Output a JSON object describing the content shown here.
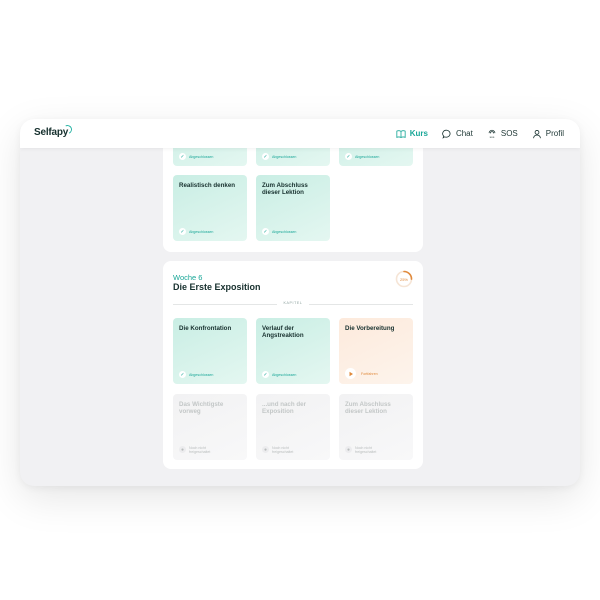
{
  "app": {
    "logo": "Selfapy",
    "nav": [
      {
        "label": "Kurs",
        "icon": "book-icon",
        "active": true
      },
      {
        "label": "Chat",
        "icon": "chat-bubble-icon",
        "active": false
      },
      {
        "label": "SOS",
        "icon": "sos-icon",
        "active": false
      },
      {
        "label": "Profil",
        "icon": "user-icon",
        "active": false
      }
    ]
  },
  "colors": {
    "accent": "#1aa798",
    "warm": "#e08a3c",
    "completed_tile": "#d5f2ea",
    "in_progress_tile": "#fdeee2",
    "locked_tile": "#f4f4f5"
  },
  "previous_week": {
    "tiles": [
      {
        "title": "",
        "status": "Abgeschlossen",
        "state": "completed"
      },
      {
        "title": "",
        "status": "Abgeschlossen",
        "state": "completed"
      },
      {
        "title": "",
        "status": "Abgeschlossen",
        "state": "completed"
      },
      {
        "title": "Realistisch denken",
        "status": "Abgeschlossen",
        "state": "completed"
      },
      {
        "title": "Zum Abschluss dieser Lektion",
        "status": "Abgeschlossen",
        "state": "completed"
      }
    ]
  },
  "week6": {
    "label": "Woche 6",
    "title": "Die Erste Exposition",
    "progress": "25%",
    "progress_value": 0.25,
    "section_label": "KAPITEL",
    "tiles": [
      {
        "title": "Die Konfrontation",
        "status": "Abgeschlossen",
        "state": "completed"
      },
      {
        "title": "Verlauf der Angstreaktion",
        "status": "Abgeschlossen",
        "state": "completed"
      },
      {
        "title": "Die Vorbereitung",
        "status": "Fortfahren",
        "state": "in-progress"
      },
      {
        "title": "Das Wichtigste vorweg",
        "status": "Noch nicht freigeschaltet",
        "state": "locked"
      },
      {
        "title": "...und nach der Exposition",
        "status": "Noch nicht freigeschaltet",
        "state": "locked"
      },
      {
        "title": "Zum Abschluss dieser Lektion",
        "status": "Noch nicht freigeschaltet",
        "state": "locked"
      }
    ]
  }
}
